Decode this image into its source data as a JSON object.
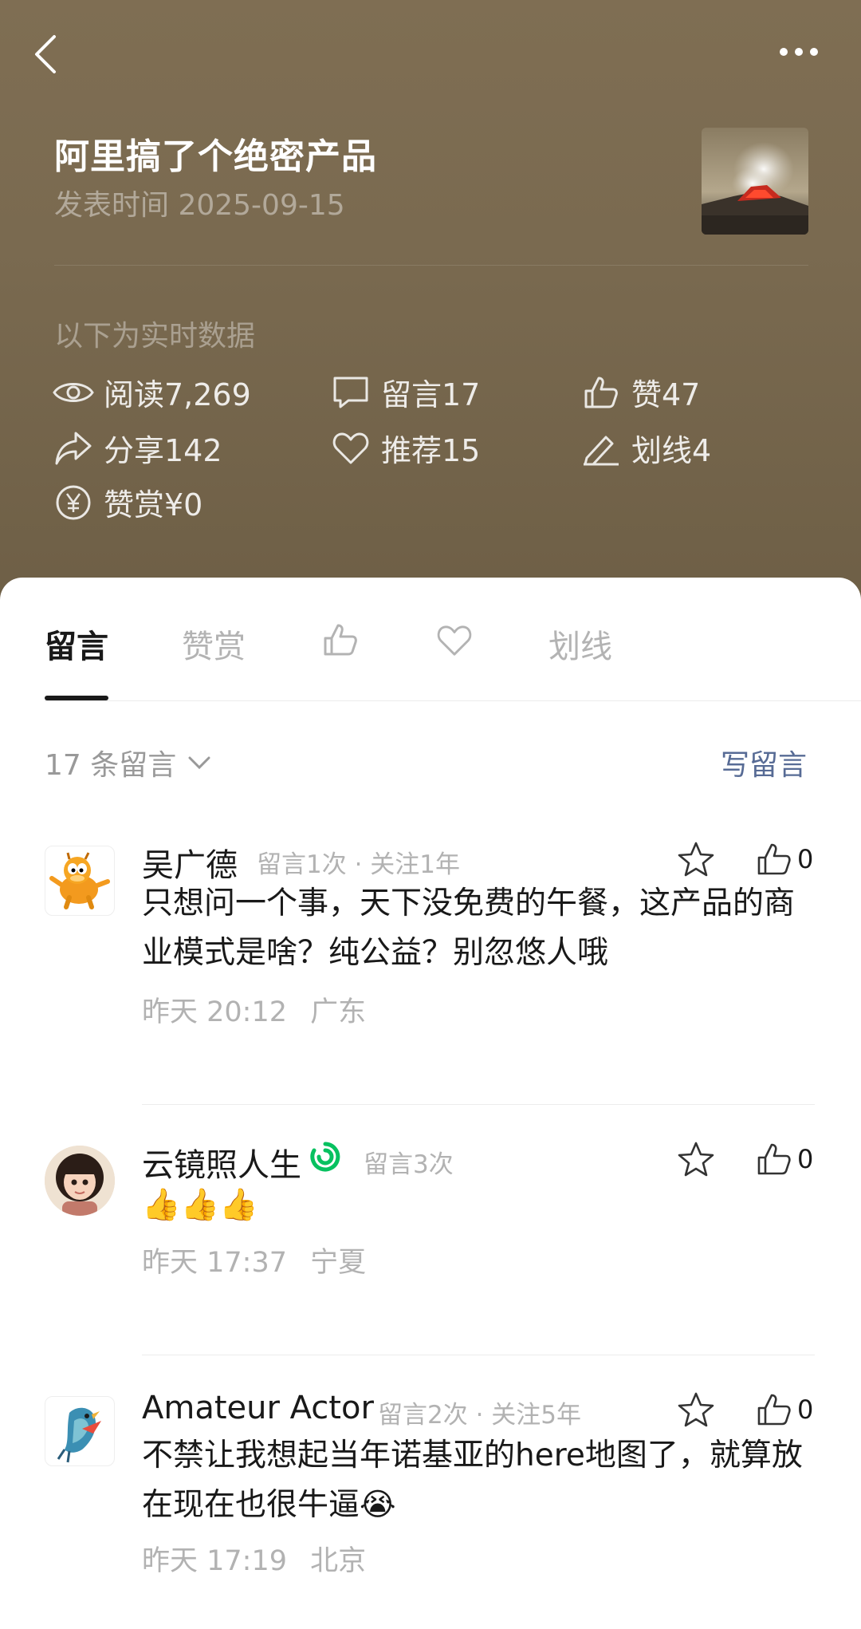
{
  "header": {
    "title": "阿里搞了个绝密产品",
    "publish_label": "发表时间 2025-09-15",
    "realtime_note": "以下为实时数据"
  },
  "stats": {
    "read": "阅读7,269",
    "comments": "留言17",
    "likes": "赞47",
    "shares": "分享142",
    "recommend": "推荐15",
    "highlight": "划线4",
    "tips": "赞赏¥0"
  },
  "tabs": {
    "comments": "留言",
    "tips": "赞赏",
    "highlight": "划线"
  },
  "comments_header": {
    "count_label": "17 条留言",
    "write_label": "写留言"
  },
  "comments": [
    {
      "name": "吴广德",
      "meta": "留言1次 · 关注1年",
      "text": "只想问一个事，天下没免费的午餐，这产品的商业模式是啥？纯公益？别忽悠人哦",
      "time": "昨天 20:12",
      "location": "广东",
      "likes": "0"
    },
    {
      "name": "云镜照人生",
      "meta": "留言3次",
      "text": "👍👍👍",
      "time": "昨天 17:37",
      "location": "宁夏",
      "likes": "0"
    },
    {
      "name": "Amateur Actor",
      "meta": "留言2次 · 关注5年",
      "text": "不禁让我想起当年诺基亚的here地图了，就算放在现在也很牛逼😭",
      "time": "昨天 17:19",
      "location": "北京",
      "likes": "0"
    }
  ],
  "colors": {
    "header_bg": "#7d6d52",
    "link": "#576b95",
    "verified": "#07c160"
  }
}
